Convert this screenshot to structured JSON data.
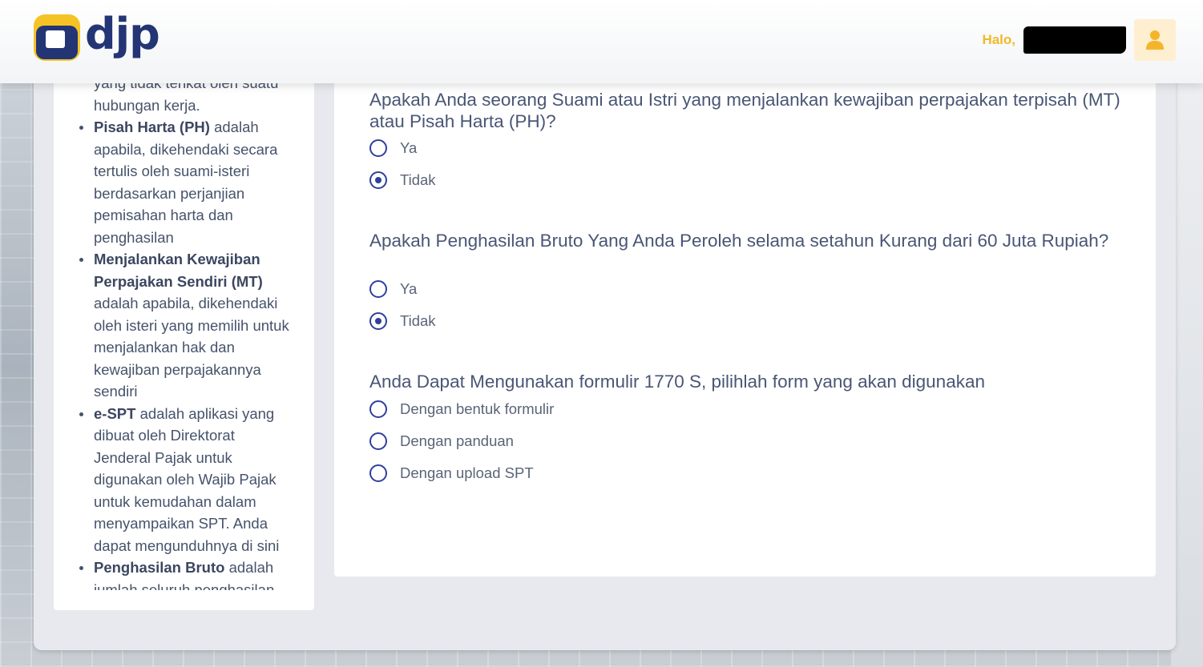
{
  "header": {
    "logo_text": "djp",
    "greeting": "Halo,",
    "avatar_icon": "user-icon",
    "accent_color": "#f0b92a"
  },
  "sidebar": {
    "items": [
      {
        "lines_partial_top": "yang tidak terikat oleh suatu",
        "text": "hubungan kerja.",
        "bulleted": false
      },
      {
        "term": "Pisah Harta (PH)",
        "text": " adalah apabila, dikehendaki secara tertulis oleh suami-isteri berdasarkan perjanjian pemisahan harta dan penghasilan",
        "bulleted": true
      },
      {
        "term": "Menjalankan Kewajiban Perpajakan Sendiri (MT)",
        "text": " adalah apabila, dikehendaki oleh isteri yang memilih untuk menjalankan hak dan kewajiban perpajakannya sendiri",
        "bulleted": true
      },
      {
        "term": "e-SPT",
        "text": " adalah aplikasi yang dibuat oleh Direktorat Jenderal Pajak untuk digunakan oleh Wajib Pajak untuk kemudahan dalam menyampaikan SPT. Anda dapat mengunduhnya di sini",
        "bulleted": true
      },
      {
        "term": "Penghasilan Bruto",
        "text": " adalah jumlah seluruh penghasilan",
        "bulleted": true
      }
    ]
  },
  "questions": [
    {
      "text": "Apakah Anda seorang Suami atau Istri yang menjalankan kewajiban perpajakan terpisah (MT) atau Pisah Harta (PH)?",
      "options": [
        {
          "label": "Ya",
          "checked": false
        },
        {
          "label": "Tidak",
          "checked": true
        }
      ]
    },
    {
      "text": "Apakah Penghasilan Bruto Yang Anda Peroleh selama setahun Kurang dari 60 Juta Rupiah?",
      "options": [
        {
          "label": "Ya",
          "checked": false
        },
        {
          "label": "Tidak",
          "checked": true
        }
      ]
    },
    {
      "text": "Anda Dapat Mengunakan formulir 1770 S, pilihlah form yang akan digunakan",
      "options": [
        {
          "label": "Dengan bentuk formulir",
          "checked": false
        },
        {
          "label": "Dengan panduan",
          "checked": false
        },
        {
          "label": "Dengan upload SPT",
          "checked": false
        }
      ]
    }
  ]
}
